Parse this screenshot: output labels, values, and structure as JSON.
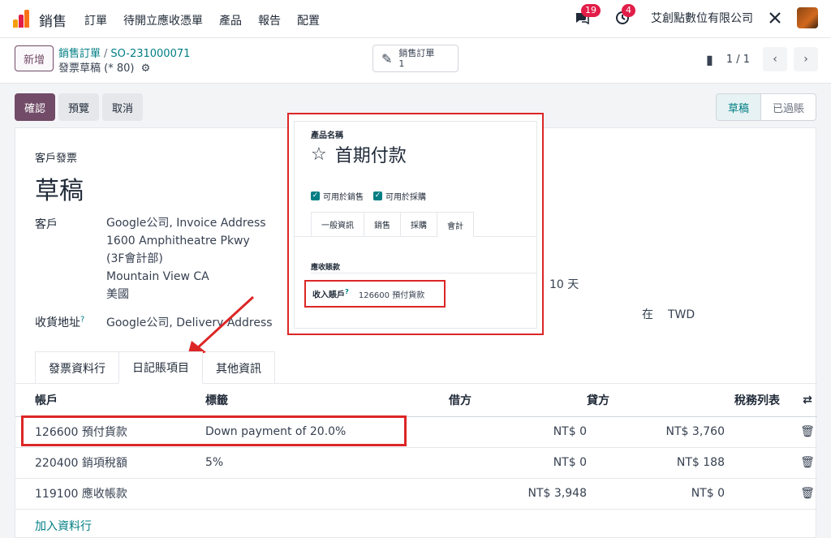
{
  "nav": {
    "app_name": "銷售",
    "menu": [
      "訂單",
      "待開立應收憑單",
      "產品",
      "報告",
      "配置"
    ],
    "messages_count": "19",
    "activities_count": "4",
    "company": "艾創點數位有限公司"
  },
  "control": {
    "new_label": "新增",
    "breadcrumb_parent": "銷售訂單",
    "breadcrumb_sep": "/",
    "breadcrumb_current": "SO-231000071",
    "subtitle": "發票草稿 (* 80)",
    "smart_button_label": "銷售訂單",
    "smart_button_count": "1",
    "pager": "1 / 1"
  },
  "actions": {
    "confirm": "確認",
    "preview": "預覽",
    "cancel": "取消"
  },
  "status": {
    "stages": [
      "草稿",
      "已過賬"
    ],
    "active": "草稿"
  },
  "invoice": {
    "type": "客戶發票",
    "state_title": "草稿",
    "customer_label": "客戶",
    "customer_lines": [
      "Google公司, Invoice Address",
      "1600 Amphitheatre Pkwy",
      "(3F會計部)",
      "Mountain View CA",
      "美國"
    ],
    "delivery_label": "收貨地址",
    "delivery_help": "?",
    "delivery_value": "Google公司, Delivery Address",
    "payment_terms_fragment": "10 天",
    "currency_prefix": "在",
    "currency": "TWD"
  },
  "tabs": [
    "發票資料行",
    "日記賬項目",
    "其他資訊"
  ],
  "active_tab": "日記賬項目",
  "journal": {
    "headers": {
      "account": "帳戶",
      "label": "標籤",
      "debit": "借方",
      "credit": "貸方",
      "tax_grid": "稅務列表"
    },
    "rows": [
      {
        "account": "126600 預付貨款",
        "label": "Down payment of 20.0%",
        "debit": "NT$ 0",
        "credit": "NT$ 3,760"
      },
      {
        "account": "220400 銷項稅額",
        "label": "5%",
        "debit": "NT$ 0",
        "credit": "NT$ 188"
      },
      {
        "account": "119100 應收帳款",
        "label": "",
        "debit": "NT$ 3,948",
        "credit": "NT$ 0"
      }
    ],
    "add_line": "加入資料行"
  },
  "popup": {
    "field_label": "產品名稱",
    "product_name": "首期付款",
    "check_sale": "可用於銷售",
    "check_purchase": "可用於採購",
    "tabs": [
      "一般資訊",
      "銷售",
      "採購",
      "會計"
    ],
    "active_tab": "會計",
    "section": "應收賬款",
    "income_label": "收入賬戶",
    "income_help": "?",
    "income_value": "126600 預付貨款"
  },
  "colors": {
    "brand": "#714b67",
    "link": "#017e84",
    "highlight": "#dc2626"
  }
}
